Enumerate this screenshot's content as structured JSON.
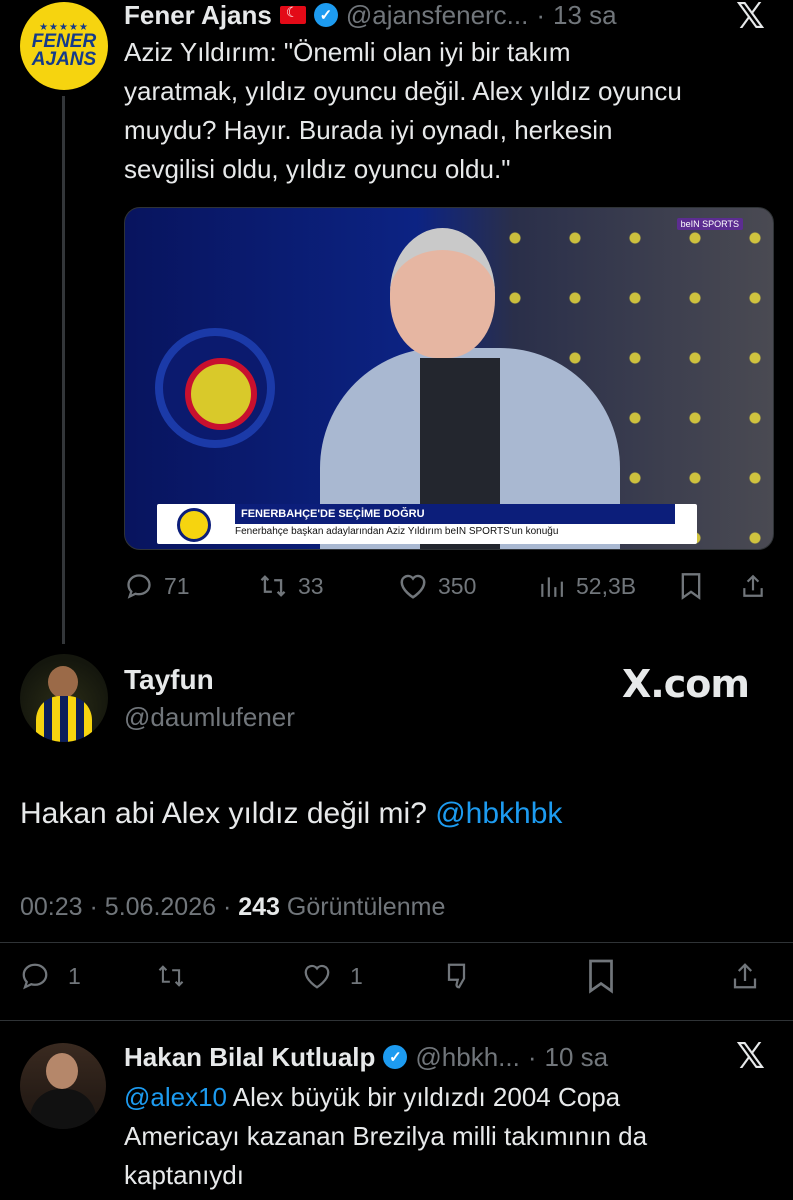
{
  "tweet1": {
    "name": "Fener Ajans",
    "handle": "@ajansfenerc...",
    "time": "13 sa",
    "avatar_text": [
      "FENER",
      "AJANS"
    ],
    "text_lines": [
      "Aziz Yıldırım: \"Önemli olan iyi bir takım",
      "yaratmak, yıldız oyuncu değil. Alex yıldız oyuncu",
      "muydu? Hayır. Burada iyi oynadı, herkesin",
      "sevgilisi oldu, yıldız oyuncu oldu.\""
    ],
    "media": {
      "banner_title": "FENERBAHÇE'DE SEÇİME DOĞRU",
      "banner_subtitle": "Fenerbahçe başkan adaylarından Aziz Yıldırım beIN SPORTS'un konuğu",
      "channel_logo": "beIN SPORTS"
    },
    "actions": {
      "replies": "71",
      "retweets": "33",
      "likes": "350",
      "views": "52,3B"
    }
  },
  "main_tweet": {
    "name": "Tayfun",
    "handle": "@daumlufener",
    "watermark": "X.com",
    "text": "Hakan abi Alex yıldız değil mi? ",
    "mention": "@hbkhbk",
    "time": "00:23",
    "date": "5.06.2026",
    "views_count": "243",
    "views_label": "Görüntülenme",
    "actions": {
      "replies": "1",
      "likes": "1"
    }
  },
  "reply": {
    "name": "Hakan Bilal Kutlualp",
    "handle": "@hbkh...",
    "time": "10 sa",
    "mention": "@alex10",
    "text_line1": " Alex büyük bir yıldızdı 2004 Copa",
    "text_line2": "Americayı kazanan Brezilya milli takımının da",
    "text_line3": "kaptanıydı"
  },
  "icons": {
    "reply": "reply-icon",
    "retweet": "retweet-icon",
    "like": "heart-icon",
    "views": "views-icon",
    "bookmark": "bookmark-icon",
    "share": "share-icon",
    "dislike": "dislike-icon",
    "x_logo": "x-logo-icon"
  },
  "colors": {
    "background": "#000000",
    "text": "#e7e9ea",
    "muted": "#71767b",
    "link": "#1d9bf0",
    "verified": "#1d9bf0",
    "fener_yellow": "#f6d40f",
    "fener_navy": "#143a8a"
  }
}
